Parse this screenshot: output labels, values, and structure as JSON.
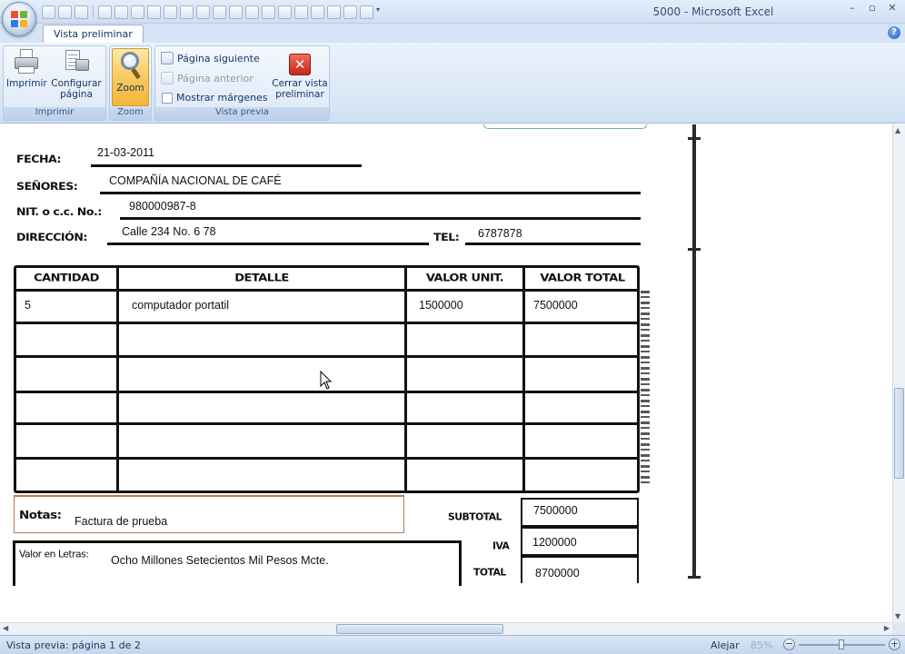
{
  "window": {
    "title": "5000 - Microsoft Excel",
    "minimize": "–",
    "restore": "▫",
    "close": "✕"
  },
  "ribbon": {
    "tab": "Vista preliminar",
    "help": "?",
    "groups": {
      "imprimir": {
        "label": "Imprimir",
        "print": "Imprimir",
        "page_setup_line1": "Configurar",
        "page_setup_line2": "página"
      },
      "zoom": {
        "label": "Zoom",
        "zoom": "Zoom"
      },
      "vista_previa": {
        "label": "Vista previa",
        "next_page": "Página siguiente",
        "prev_page": "Página anterior",
        "show_margins": "Mostrar márgenes",
        "close_line1": "Cerrar vista",
        "close_line2": "preliminar"
      }
    }
  },
  "invoice": {
    "fecha_label": "FECHA:",
    "fecha": "21-03-2011",
    "senores_label": "SEÑORES:",
    "senores": "COMPAÑÍA NACIONAL DE CAFÉ",
    "nit_label": "NIT. o c.c. No.:",
    "nit": "980000987-8",
    "direccion_label": "DIRECCIÓN:",
    "direccion": "Calle 234 No. 6 78",
    "tel_label": "TEL:",
    "tel": "6787878",
    "columns": [
      "CANTIDAD",
      "DETALLE",
      "VALOR UNIT.",
      "VALOR TOTAL"
    ],
    "rows": [
      {
        "cantidad": "5",
        "detalle": "computador portatil",
        "unit": "1500000",
        "total": "7500000"
      }
    ],
    "notas_label": "Notas:",
    "notas": "Factura de prueba",
    "letras_label": "Valor en Letras:",
    "letras": "Ocho Millones Setecientos Mil Pesos Mcte.",
    "subtotal_label": "SUBTOTAL",
    "subtotal": "7500000",
    "iva_label": "IVA",
    "iva": "1200000",
    "total_label": "TOTAL",
    "total": "8700000"
  },
  "status": {
    "text": "Vista previa: página 1 de 2",
    "zoom_label": "Alejar",
    "zoom_pct": "85%",
    "minus": "−",
    "plus": "+"
  }
}
